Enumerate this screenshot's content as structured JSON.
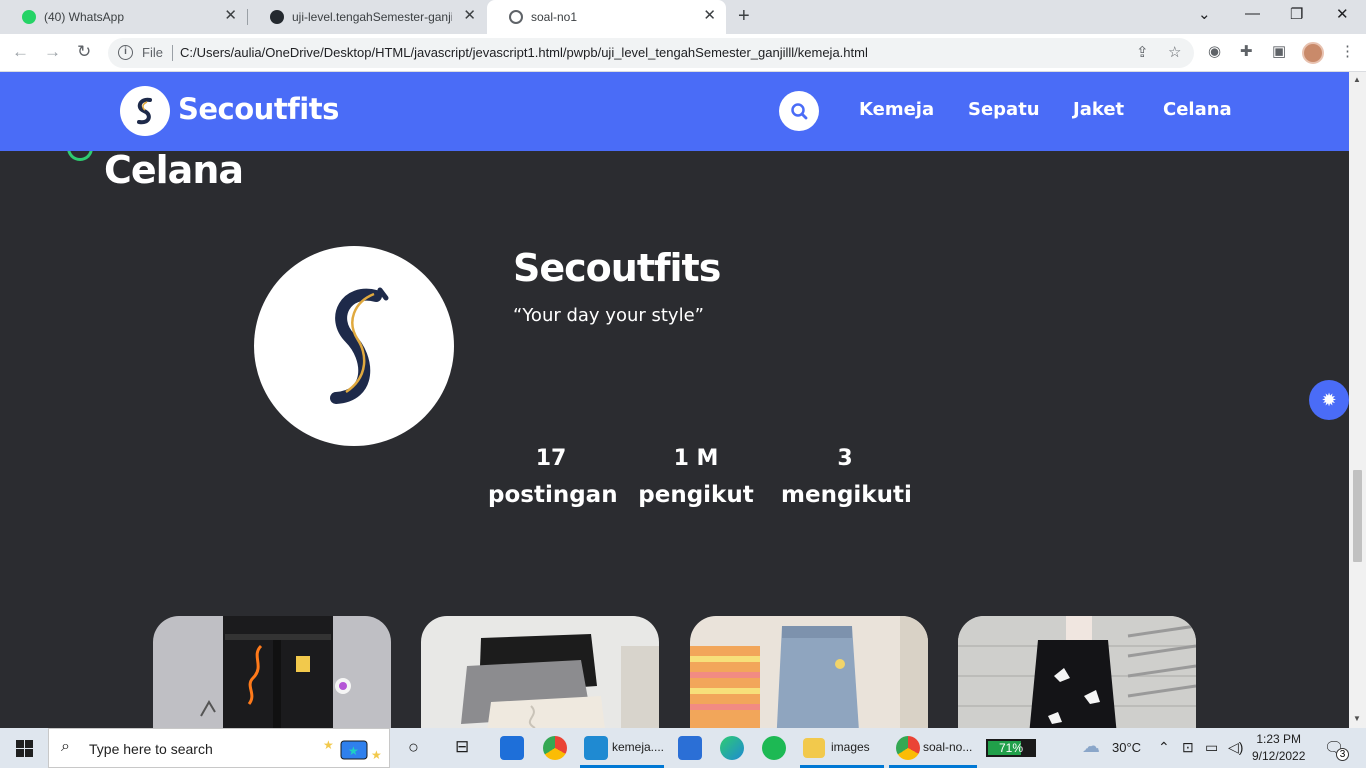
{
  "browser": {
    "tabs": [
      {
        "title": "(40) WhatsApp",
        "favicon": "whatsapp-icon",
        "badge": "40",
        "active": false
      },
      {
        "title": "uji-level.tengahSemester-ganjil/u",
        "favicon": "github-icon",
        "active": false
      },
      {
        "title": "soal-no1",
        "favicon": "globe-icon",
        "active": true
      }
    ],
    "address": {
      "scheme_label": "File",
      "url": "C:/Users/aulia/OneDrive/Desktop/HTML/javascript/jevascript1.html/pwpb/uji_level_tengahSemester_ganjilll/kemeja.html"
    }
  },
  "page": {
    "brand": "Secoutfits",
    "nav_links": [
      "Kemeja",
      "Sepatu",
      "Jaket",
      "Celana"
    ],
    "section_title": "Celana",
    "profile": {
      "name": "Secoutfits",
      "tagline": "“Your day your style”"
    },
    "stats": [
      {
        "value": "17",
        "label": "postingan"
      },
      {
        "value": "1 M",
        "label": "pengikut"
      },
      {
        "value": "3",
        "label": "mengikuti"
      }
    ],
    "colors": {
      "navbar": "#4a6cf7",
      "background": "#2b2c30",
      "accent_ring": "#2ecc71",
      "logo_navy": "#1e2a4a",
      "logo_gold": "#e0a93f"
    },
    "products": [
      {
        "name": "black cargo pants with patches"
      },
      {
        "name": "grey and white sweat shorts"
      },
      {
        "name": "light denim jeans"
      },
      {
        "name": "black butterfly print pants"
      }
    ]
  },
  "taskbar": {
    "search_placeholder": "Type here to search",
    "apps": [
      {
        "label": "kemeja....",
        "icon": "vscode-icon"
      },
      {
        "label": "images",
        "icon": "folder-icon"
      },
      {
        "label": "soal-no...",
        "icon": "chrome-icon"
      }
    ],
    "battery": "71%",
    "battery_level": 0.71,
    "weather": "30°C",
    "time": "1:23 PM",
    "date": "9/12/2022",
    "notifications": "3"
  }
}
